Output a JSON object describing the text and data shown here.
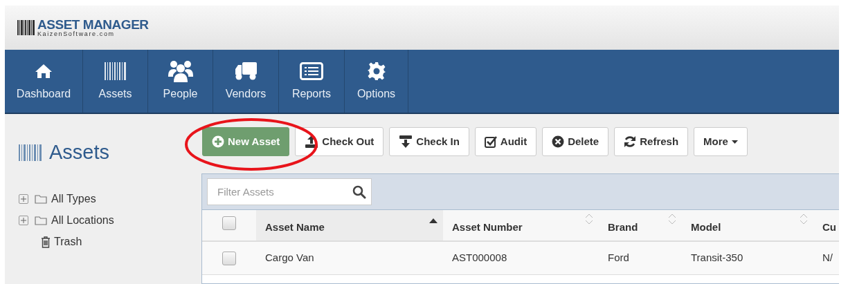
{
  "logo": {
    "title": "ASSET MANAGER",
    "subtitle": "KaizenSoftware.com"
  },
  "nav": [
    {
      "label": "Dashboard"
    },
    {
      "label": "Assets"
    },
    {
      "label": "People"
    },
    {
      "label": "Vendors"
    },
    {
      "label": "Reports"
    },
    {
      "label": "Options"
    }
  ],
  "sidebar": {
    "title": "Assets",
    "tree": [
      {
        "label": "All Types",
        "kind": "folder",
        "expanded": false
      },
      {
        "label": "All Locations",
        "kind": "folder",
        "expanded": false
      },
      {
        "label": "Trash",
        "kind": "trash"
      }
    ]
  },
  "toolbar": [
    {
      "label": "New Asset",
      "kind": "primary"
    },
    {
      "label": "Check Out",
      "kind": "default"
    },
    {
      "label": "Check In",
      "kind": "default"
    },
    {
      "label": "Audit",
      "kind": "default"
    },
    {
      "label": "Delete",
      "kind": "default"
    },
    {
      "label": "Refresh",
      "kind": "default"
    },
    {
      "label": "More",
      "kind": "dropdown"
    }
  ],
  "filter": {
    "placeholder": "Filter Assets"
  },
  "table": {
    "select_all_checked": false,
    "columns": [
      {
        "label": "Asset Name",
        "sorted": true
      },
      {
        "label": "Asset Number",
        "sorted": false
      },
      {
        "label": "Brand",
        "sorted": false
      },
      {
        "label": "Model",
        "sorted": false
      },
      {
        "label": "Cu"
      }
    ],
    "rows": [
      {
        "checked": false,
        "cells": [
          "Cargo Van",
          "AST000008",
          "Ford",
          "Transit-350",
          "N/"
        ]
      }
    ]
  }
}
